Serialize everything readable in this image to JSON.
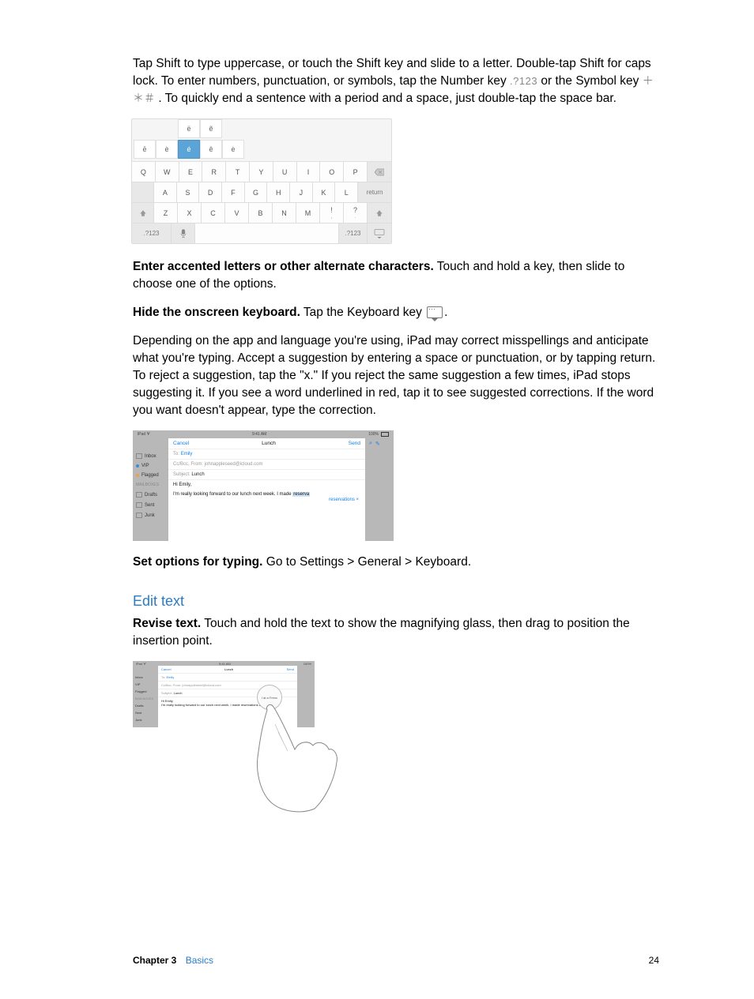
{
  "intro_paragraph_pre": "Tap Shift to type uppercase, or touch the Shift key and slide to a letter. Double-tap Shift for caps lock. To enter numbers, punctuation, or symbols, tap the Number key ",
  "number_key_label": ".?123",
  "intro_mid": " or the Symbol key ",
  "symbol_key_label": "＋＊＃",
  "intro_post": ". To quickly end a sentence with a period and a space, just double-tap the space bar.",
  "keyboard": {
    "accents_top": [
      "ë",
      "ẽ"
    ],
    "accents_bottom_pre": [
      "ē",
      "è"
    ],
    "accents_selected": "é",
    "accents_bottom_post": [
      "ê",
      "ė"
    ],
    "row1": [
      "Q",
      "W",
      "E",
      "R",
      "T",
      "Y",
      "U",
      "I",
      "O",
      "P"
    ],
    "row2": [
      "A",
      "S",
      "D",
      "F",
      "G",
      "H",
      "J",
      "K",
      "L"
    ],
    "row2_return": "return",
    "row3": [
      "Z",
      "X",
      "C",
      "V",
      "B",
      "N",
      "M"
    ],
    "row3_punct": [
      "!",
      ","
    ],
    "row3_q": [
      "?",
      "."
    ],
    "row4_num": ".?123"
  },
  "para_accent_bold": "Enter accented letters or other alternate characters.",
  "para_accent_rest": " Touch and hold a key, then slide to choose one of the options.",
  "para_hide_bold": "Hide the onscreen keyboard.",
  "para_hide_rest_pre": " Tap the Keyboard key ",
  "para_hide_rest_post": ".",
  "para_correct": "Depending on the app and language you're using, iPad may correct misspellings and anticipate what you're typing. Accept a suggestion by entering a space or punctuation, or by tapping return. To reject a suggestion, tap the \"x.\" If you reject the same suggestion a few times, iPad stops suggesting it. If you see a word underlined in red, tap it to see suggested corrections. If the word you want doesn't appear, type the correction.",
  "mail": {
    "status_left": "iPad ᗐ",
    "status_time": "9:41 AM",
    "status_batt": "100%",
    "sidebar": {
      "mailboxes": "MAILBOXES",
      "inbox": "Inbox",
      "vip": "VIP",
      "flagged": "Flagged",
      "drafts": "Drafts",
      "sent": "Sent",
      "junk": "Junk"
    },
    "cancel": "Cancel",
    "title": "Lunch",
    "send": "Send",
    "to_label": "To:",
    "to_value": "Emily",
    "cc_label": "Cc/Bcc, From:",
    "cc_value": "johnappleseed@icloud.com",
    "subj_label": "Subject:",
    "subj_value": "Lunch",
    "greeting": "Hi Emily,",
    "body_pre": "I'm really looking forward to our lunch next week. I made ",
    "body_hl": "reserva",
    "suggestion": "reservations ×"
  },
  "para_options_bold": "Set options for typing.",
  "para_options_rest": " Go to Settings > General > Keyboard.",
  "heading_edit": "Edit text",
  "para_revise_bold": "Revise text.",
  "para_revise_rest": " Touch and hold the text to show the magnifying glass, then drag to position the insertion point.",
  "edit_fig": {
    "body_full": "I'm really looking forward to our lunch next week. I made reservations at",
    "loupe_text": "I at a Frenc"
  },
  "footer": {
    "chapter_label": "Chapter 3",
    "chapter_title": "Basics",
    "page": "24"
  }
}
